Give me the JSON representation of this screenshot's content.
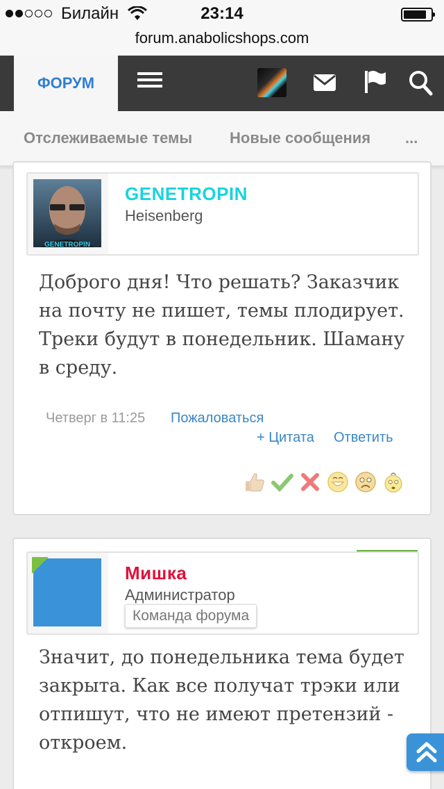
{
  "status_bar": {
    "carrier": "Билайн",
    "time": "23:14"
  },
  "browser": {
    "url": "forum.anabolicshops.com"
  },
  "nav": {
    "forum_tab": "ФОРУМ"
  },
  "subnav": {
    "items": [
      "Отслеживаемые темы",
      "Новые сообщения",
      "..."
    ]
  },
  "posts": [
    {
      "username": "GENETROPIN",
      "username_color": "#19d3df",
      "user_title": "Heisenberg",
      "avatar_caption": "GENETROPIN",
      "body": "Доброго дня! Что решать? Заказчик на почту не пишет, темы плодирует. Треки будут в понедельник. Шаману в среду.",
      "date": "Четверг в 11:25",
      "report": "Пожаловаться",
      "quote": "+ Цитата",
      "reply": "Ответить",
      "reactions": [
        "thumbs-up",
        "check",
        "cross",
        "grin",
        "sad",
        "confused"
      ]
    },
    {
      "username": "Мишка",
      "username_color": "#e0103a",
      "user_title": "Администратор",
      "banner": "Команда форума",
      "body": "Значит, до понедельника тема будет закрыта. Как все получат трэки или отпишут, что не имеют претензий - откроем."
    }
  ],
  "colors": {
    "accent": "#2f7fd0",
    "navbar": "#3a3a3a",
    "admin_avatar": "#3a93d8"
  }
}
